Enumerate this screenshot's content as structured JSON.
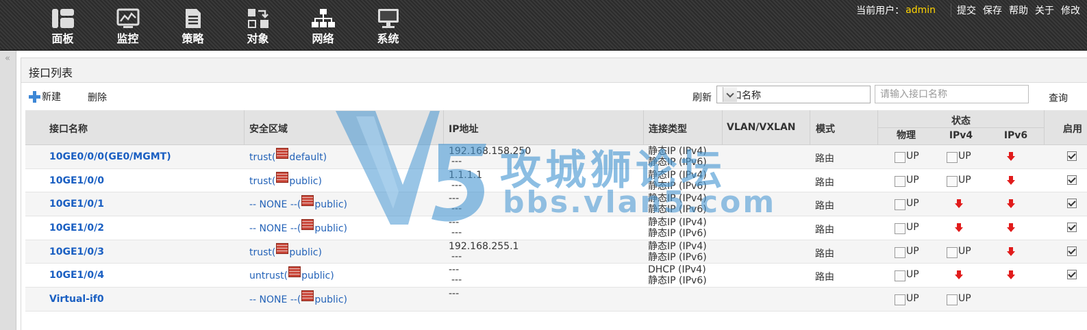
{
  "topnav": {
    "items": [
      {
        "label": "面板",
        "icon": "dashboard-icon"
      },
      {
        "label": "监控",
        "icon": "monitor-icon"
      },
      {
        "label": "策略",
        "icon": "policy-icon"
      },
      {
        "label": "对象",
        "icon": "object-icon"
      },
      {
        "label": "网络",
        "icon": "network-icon",
        "active": true
      },
      {
        "label": "系统",
        "icon": "system-icon"
      }
    ]
  },
  "userbar": {
    "current_user_label": "当前用户：",
    "username": "admin",
    "links": [
      "提交",
      "保存",
      "帮助",
      "关于",
      "修改"
    ]
  },
  "panel": {
    "title": "接口列表"
  },
  "toolbar": {
    "new_label": "新建",
    "delete_label": "删除",
    "refresh_label": "刷新",
    "filter_selected": "接口名称",
    "search_placeholder": "请输入接口名称",
    "query_label": "查询"
  },
  "table": {
    "headers": {
      "name": "接口名称",
      "zone": "安全区域",
      "ip": "IP地址",
      "conn": "连接类型",
      "vlan": "VLAN/VXLAN",
      "mode": "模式",
      "status": "状态",
      "phys": "物理",
      "ipv4": "IPv4",
      "ipv6": "IPv6",
      "enable": "启用"
    },
    "rows": [
      {
        "name": "10GE0/0/0(GE0/MGMT)",
        "zone_prefix": "trust(",
        "vsys": "default)",
        "ip1": "192.168.158.250",
        "ip2": "---",
        "conn1": "静态IP (IPv4)",
        "conn2": "静态IP (IPv6)",
        "mode": "路由",
        "phys": "UP",
        "ipv4": "UP",
        "ipv6": "down",
        "enabled": true
      },
      {
        "name": "10GE1/0/0",
        "zone_prefix": "trust(",
        "vsys": "public)",
        "ip1": "1.1.1.1",
        "ip2": "---",
        "conn1": "静态IP (IPv4)",
        "conn2": "静态IP (IPv6)",
        "mode": "路由",
        "phys": "UP",
        "ipv4": "UP",
        "ipv6": "down",
        "enabled": true
      },
      {
        "name": "10GE1/0/1",
        "zone_prefix": "-- NONE --(",
        "vsys": "public)",
        "ip1": "---",
        "ip2": "---",
        "conn1": "静态IP (IPv4)",
        "conn2": "静态IP (IPv6)",
        "mode": "路由",
        "phys": "UP",
        "ipv4": "down",
        "ipv6": "down",
        "enabled": true
      },
      {
        "name": "10GE1/0/2",
        "zone_prefix": "-- NONE --(",
        "vsys": "public)",
        "ip1": "---",
        "ip2": "---",
        "conn1": "静态IP (IPv4)",
        "conn2": "静态IP (IPv6)",
        "mode": "路由",
        "phys": "UP",
        "ipv4": "down",
        "ipv6": "down",
        "enabled": true
      },
      {
        "name": "10GE1/0/3",
        "zone_prefix": "trust(",
        "vsys": "public)",
        "ip1": "192.168.255.1",
        "ip2": "---",
        "conn1": "静态IP (IPv4)",
        "conn2": "静态IP (IPv6)",
        "mode": "路由",
        "phys": "UP",
        "ipv4": "UP",
        "ipv6": "down",
        "enabled": true
      },
      {
        "name": "10GE1/0/4",
        "zone_prefix": "untrust(",
        "vsys": "public)",
        "ip1": "---",
        "ip2": "---",
        "conn1": "DHCP (IPv4)",
        "conn2": "静态IP (IPv6)",
        "mode": "路由",
        "phys": "UP",
        "ipv4": "down",
        "ipv6": "down",
        "enabled": true
      },
      {
        "name": "Virtual-if0",
        "zone_prefix": "-- NONE --(",
        "vsys": "public)",
        "ip1": "---",
        "ip2": "",
        "conn1": "",
        "conn2": "",
        "mode": "",
        "phys": "UP",
        "ipv4": "UP",
        "ipv6": "",
        "enabled": false
      }
    ]
  },
  "watermark": {
    "text": "攻城狮论坛",
    "url": "bbs.vlan5.com"
  },
  "colors": {
    "link": "#1a5fc2",
    "username": "#ffd400",
    "down_arrow": "#e11b1b",
    "watermark": "#4696d2"
  }
}
